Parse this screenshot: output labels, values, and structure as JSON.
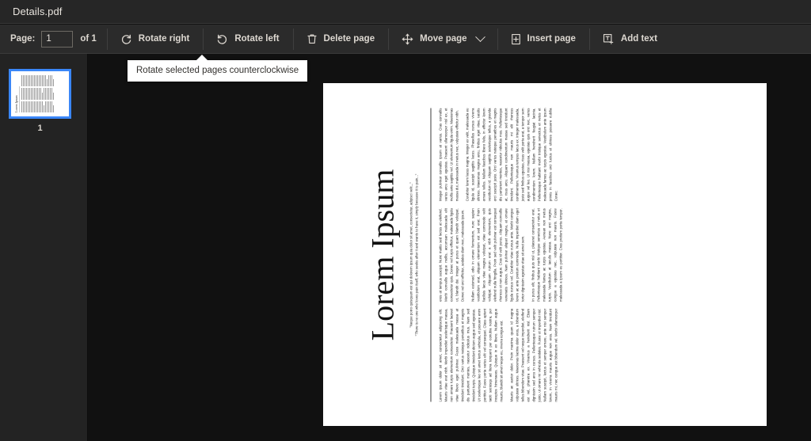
{
  "titlebar": {
    "document_name": "Details.pdf"
  },
  "toolbar": {
    "page_label": "Page:",
    "page_value": "1",
    "page_of": "of 1",
    "buttons": [
      {
        "id": "rotate-right",
        "label": "Rotate right",
        "icon": "rotate-clockwise-icon"
      },
      {
        "id": "rotate-left",
        "label": "Rotate left",
        "icon": "rotate-counterclockwise-icon"
      },
      {
        "id": "delete-page",
        "label": "Delete page",
        "icon": "trash-icon"
      },
      {
        "id": "move-page",
        "label": "Move page",
        "icon": "move-arrows-icon",
        "has_dropdown": true
      },
      {
        "id": "insert-page",
        "label": "Insert page",
        "icon": "insert-page-icon"
      },
      {
        "id": "add-text",
        "label": "Add text",
        "icon": "add-text-icon"
      }
    ]
  },
  "tooltip": {
    "text": "Rotate selected pages counterclockwise",
    "anchor_button": "rotate-left"
  },
  "sidebar": {
    "thumbnails": [
      {
        "page_number": "1",
        "selected": true,
        "rotation": -90,
        "selection_color": "#3a86f7"
      }
    ]
  },
  "document": {
    "rotation_degrees": -90,
    "title": "Lorem Ipsum",
    "quote_line_1": "\"Neque porro quisquam est qui dolorem ipsum quia dolor sit amet, consectetur, adipisci velit...\"",
    "quote_line_2": "\"There is no one who loves pain itself, who seeks after it and wants to have it, simply because it is pain...\"",
    "columns": [
      {
        "paragraphs": [
          "Lorem ipsum dolor sit amet, consectetur adipiscing elit. Mauris vitae erat nibh. Morbi imperdiet scelerisque massa, non ornare turpis elementum consectetur. Praesent laoreet vitae libero eget pulvinar. Fusce malesuada massa at tincidunt tincidunt. Orci varius natoque penatibus et magnis dis parturient montes, nascetur ridiculus mus. Nam sed tincidunt turpis. Quisque tincidunt dictum augue sed egestas. Ut scelerisque leo sit amet lectus vehicula, et posuere enim porttitor. Fusce porta varius elit vel consequat. Class aptent taciti sociosqu ad litora torquent per conubia nostra, per inceptos himenaeos. Quisque in ex libero. Nullam augue mauris, blandit sit amet neque eu, viverra congue est.",
          "Mauris ac auctor dolor. Proin maxima quam id magna vulputate ultrices. Maecenas lacinia dolor eros, a bibendum tellus bibendum vitae. Praesent vel neque imperdiet, eleifend est vel, pharetra ex. Vivamus a hendrerit nisl. Etiam dignissim sed arcu in cursus. Pellentesque rutrum semper justo, ut ornare mi vehicula sodales. Fusce ut imperdiet nisl. Nullam suscipit, lectus et semper ornare, ante nisi semper lorem, in viverra mauris augue non eros. Nam tincidunt mauris mi, nec congue est bibendum vel. Morbi ullamcorper eros at tempus suscipit. Nunc mattis sed lectus at eleifend. Morbi convallis augue mollis, accumsan malesuada elit consectetur quis. Donec vel turpis efficitur, malesuada ligula ut, blandit dui. Integer at purus et quam blandit volutpat. Donec vel orci efficitur, sodales diam nec, malesuada ipsum.",
          "Nullam euismod, odio in ornare fermentum, nunc sapien vestibulum erat, aliquam elementum est sed erat. Proin facilisis lacus vitae magna volutpat, vitae commodo velit volutpat. Aliquam rutrum erat a nibh elementum, quis eleifend nulla fringilla. Proin sed velit pulvinar est consequat rhoncus ut non augue. Cras id velit purus. Aliquam convallis venenatis ultrices. Nam pulvinar aliquet magna, at ornare ligula cursus vel. Curabitur vitae cursus ante. Morbi congue lorem ac ante pretium commodo. Nulla imperdiet diam eget tortor dignissim egestas vitae sit amet sem.",
          "In purus elit, finibus quis nisl ut, placerat consectetur erat. Pellentesque habitant morbi tristique senectus et netus et malesuada fames ac turpis egestas. Aenean non metus turpis. Vestibulum at iaculis massa. Nunc orci magna, congue a egestas nec, vulputate non mauris. Fusce malesuada a ipsum eu porttitor. Cras pretium porta tempor. Integer pulvinar convallis ipsum at varius. Cras convallis varius arcu eget egestas. Praesent ullamcorper nisl ex, et mollis ante sagittis vel. Ut elementum ligula enim. Maecenas massa dui, malesuada in metus nec, vulputate efficitur nibh.",
          "Curabitur lorem lacus magna. Integer ex velit, malesuada eu ligula id, suscipit sagittis lacus. Phasellus cursus viverra ultrices. Maecenas magna arcu, finibus eget vitae, iaculis ornare tellus. Nullam faucibus libero felis, in efficitur lorem vestibulum id. Aliquam sagittis scelerisque tellus, a gravida orci suscipit justo. Orci varius natoque penatibus et magnis dis parturient montes, nascetur ridiculus mus. Pellentesque at, risus arcu. Aliquam condimentum massa sed tincidunt tincidunt. Pellentesque non mauris mi elit rhoncus condimentum. Vivamus tempus lacus ex. Integer malesuada, justo sed finibus egestas, risus velit porta erat, a tempor sem augue vel leo. Ut nisi massa, egestas quis orci nec, varius condimentum lorem. Nullam hendrerit feugiat lacinia. Pellentesque habitant morbi tristique senectus et netus et malesuada fames ac turpis egestas. Vestibulum ante ipsum primis in faucibus orci luctus et ultrices posuere cubilia Curae;"
        ]
      }
    ]
  },
  "colors": {
    "titlebar_bg": "#262626",
    "toolbar_bg": "#2b2b2b",
    "sidebar_bg": "#232323",
    "canvas_bg": "#111111",
    "text": "#ddd8d1",
    "selection": "#3a86f7",
    "tooltip_bg": "#ffffff"
  }
}
